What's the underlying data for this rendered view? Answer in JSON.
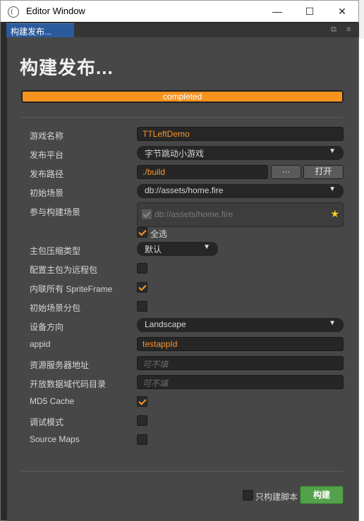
{
  "window": {
    "title": "Editor Window",
    "minimize": "—",
    "maximize": "☐",
    "close": "✕"
  },
  "tab": {
    "label": "构建发布...",
    "popout_icon": "popout-icon",
    "menu_icon": "menu-icon"
  },
  "heading": "构建发布...",
  "progress": {
    "text": "completed",
    "value": 1.0,
    "color": "#f7931e"
  },
  "form": {
    "game_name": {
      "label": "游戏名称",
      "value": "TTLeftDemo"
    },
    "platform": {
      "label": "发布平台",
      "value": "字节跳动小游戏"
    },
    "build_path": {
      "label": "发布路径",
      "value": "./build",
      "browse_label": "···",
      "open_label": "打开"
    },
    "start_scene": {
      "label": "初始场景",
      "value": "db://assets/home.fire"
    },
    "included_scenes": {
      "label": "参与构建场景",
      "scene": "db://assets/home.fire",
      "select_all_label": "全选"
    },
    "compression": {
      "label": "主包压缩类型",
      "value": "默认"
    },
    "remote_main": {
      "label": "配置主包为远程包",
      "checked": false
    },
    "inline_spriteframe": {
      "label": "内联所有 SpriteFrame",
      "checked": true
    },
    "start_scene_subpackage": {
      "label": "初始场景分包",
      "checked": false
    },
    "orientation": {
      "label": "设备方向",
      "value": "Landscape"
    },
    "appid": {
      "label": "appid",
      "value": "testappId"
    },
    "remote_server": {
      "label": "资源服务器地址",
      "placeholder": "可不填"
    },
    "open_data": {
      "label": "开放数据域代码目录",
      "placeholder": "可不填"
    },
    "md5_cache": {
      "label": "MD5 Cache",
      "checked": true
    },
    "debug_mode": {
      "label": "调试模式",
      "checked": false
    },
    "source_maps": {
      "label": "Source Maps",
      "checked": false
    }
  },
  "footer": {
    "script_only_label": "只构建脚本",
    "build_label": "构建"
  },
  "colors": {
    "accent": "#fd942b",
    "build": "#53a14a",
    "panel": "#474747"
  }
}
